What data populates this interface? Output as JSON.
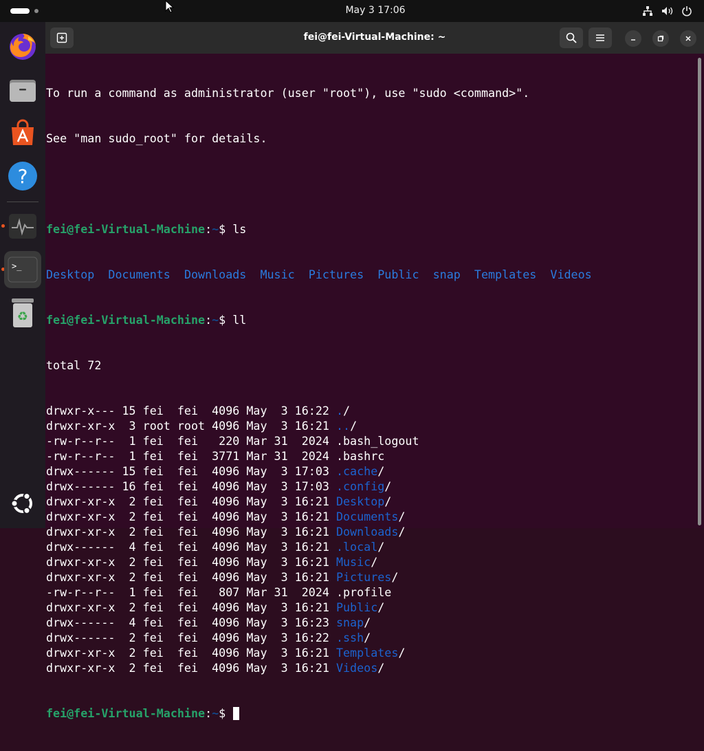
{
  "topbar": {
    "clock": "May 3  17:06",
    "icons": [
      "network-icon",
      "volume-icon",
      "power-icon"
    ]
  },
  "dock": {
    "items": [
      {
        "name": "firefox",
        "icon": "firefox-icon",
        "running": true
      },
      {
        "name": "files",
        "icon": "files-icon",
        "running": false
      },
      {
        "name": "app-center",
        "icon": "app-center-icon",
        "running": false
      },
      {
        "name": "help",
        "icon": "help-icon",
        "running": false
      },
      {
        "name": "system-monitor",
        "icon": "system-monitor-icon",
        "running": true
      },
      {
        "name": "terminal",
        "icon": "terminal-icon",
        "running": true,
        "active": true
      },
      {
        "name": "trash",
        "icon": "trash-icon",
        "running": false
      }
    ],
    "show_apps_icon": "ubuntu-logo-icon"
  },
  "window": {
    "title": "fei@fei-Virtual-Machine: ~",
    "buttons": [
      "new-tab-icon",
      "search-icon",
      "menu-icon",
      "minimize-icon",
      "restore-icon",
      "close-icon"
    ]
  },
  "terminal": {
    "motd": [
      "To run a command as administrator (user \"root\"), use \"sudo <command>\".",
      "See \"man sudo_root\" for details."
    ],
    "prompt_user": "fei@fei-Virtual-Machine",
    "prompt_path": "~",
    "cmd_ls": "ls",
    "ls_output": [
      "Desktop",
      "Documents",
      "Downloads",
      "Music",
      "Pictures",
      "Public",
      "snap",
      "Templates",
      "Videos"
    ],
    "cmd_ll": "ll",
    "total": "total 72",
    "entries": [
      {
        "meta": "drwxr-x--- 15 fei  fei  4096 May  3 16:22 ",
        "name": ".",
        "suffix": "/",
        "is_dir": true
      },
      {
        "meta": "drwxr-xr-x  3 root root 4096 May  3 16:21 ",
        "name": "..",
        "suffix": "/",
        "is_dir": true
      },
      {
        "meta": "-rw-r--r--  1 fei  fei   220 Mar 31  2024 ",
        "name": ".bash_logout",
        "suffix": "",
        "is_dir": false
      },
      {
        "meta": "-rw-r--r--  1 fei  fei  3771 Mar 31  2024 ",
        "name": ".bashrc",
        "suffix": "",
        "is_dir": false
      },
      {
        "meta": "drwx------ 15 fei  fei  4096 May  3 17:03 ",
        "name": ".cache",
        "suffix": "/",
        "is_dir": true
      },
      {
        "meta": "drwx------ 16 fei  fei  4096 May  3 17:03 ",
        "name": ".config",
        "suffix": "/",
        "is_dir": true
      },
      {
        "meta": "drwxr-xr-x  2 fei  fei  4096 May  3 16:21 ",
        "name": "Desktop",
        "suffix": "/",
        "is_dir": true
      },
      {
        "meta": "drwxr-xr-x  2 fei  fei  4096 May  3 16:21 ",
        "name": "Documents",
        "suffix": "/",
        "is_dir": true
      },
      {
        "meta": "drwxr-xr-x  2 fei  fei  4096 May  3 16:21 ",
        "name": "Downloads",
        "suffix": "/",
        "is_dir": true
      },
      {
        "meta": "drwx------  4 fei  fei  4096 May  3 16:21 ",
        "name": ".local",
        "suffix": "/",
        "is_dir": true
      },
      {
        "meta": "drwxr-xr-x  2 fei  fei  4096 May  3 16:21 ",
        "name": "Music",
        "suffix": "/",
        "is_dir": true
      },
      {
        "meta": "drwxr-xr-x  2 fei  fei  4096 May  3 16:21 ",
        "name": "Pictures",
        "suffix": "/",
        "is_dir": true
      },
      {
        "meta": "-rw-r--r--  1 fei  fei   807 Mar 31  2024 ",
        "name": ".profile",
        "suffix": "",
        "is_dir": false
      },
      {
        "meta": "drwxr-xr-x  2 fei  fei  4096 May  3 16:21 ",
        "name": "Public",
        "suffix": "/",
        "is_dir": true
      },
      {
        "meta": "drwx------  4 fei  fei  4096 May  3 16:23 ",
        "name": "snap",
        "suffix": "/",
        "is_dir": true
      },
      {
        "meta": "drwx------  2 fei  fei  4096 May  3 16:22 ",
        "name": ".ssh",
        "suffix": "/",
        "is_dir": true
      },
      {
        "meta": "drwxr-xr-x  2 fei  fei  4096 May  3 16:21 ",
        "name": "Templates",
        "suffix": "/",
        "is_dir": true
      },
      {
        "meta": "drwxr-xr-x  2 fei  fei  4096 May  3 16:21 ",
        "name": "Videos",
        "suffix": "/",
        "is_dir": true
      }
    ]
  },
  "colors": {
    "terminal_bg": "#300a24",
    "prompt_user": "#26a269",
    "prompt_path": "#12488b",
    "directory": "#1c63cf",
    "accent": "#e95420"
  }
}
